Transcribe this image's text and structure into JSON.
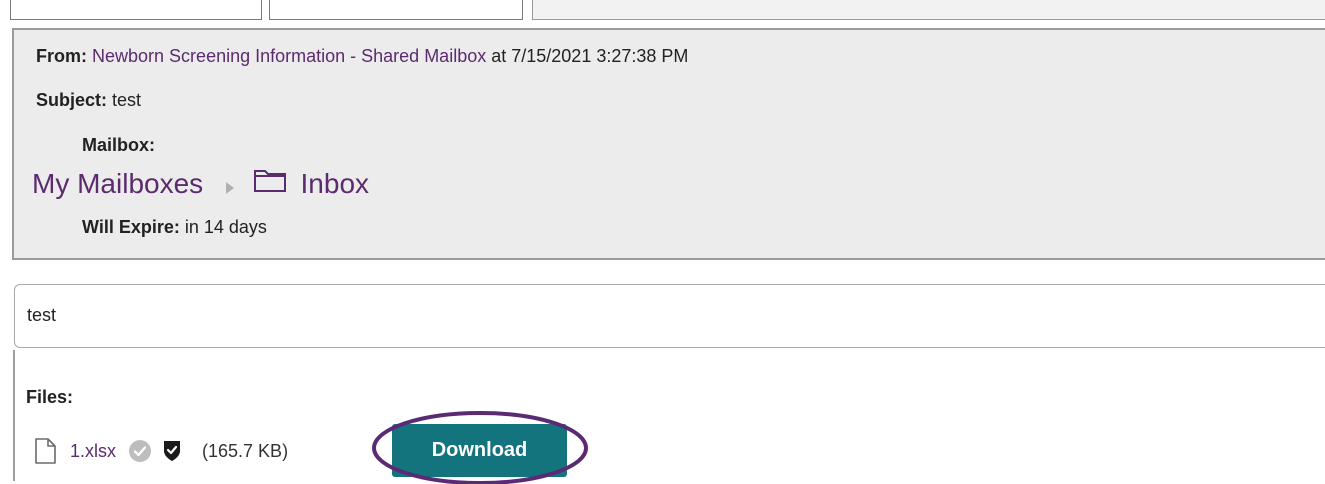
{
  "message": {
    "from_label": "From:",
    "from_name": "Newborn Screening Information - Shared Mailbox",
    "from_at": "at 7/15/2021 3:27:38 PM",
    "subject_label": "Subject:",
    "subject_value": "test",
    "mailbox_label": "Mailbox:",
    "breadcrumb": {
      "root": "My Mailboxes",
      "folder": "Inbox"
    },
    "expire_label": "Will Expire:",
    "expire_value": "in 14 days",
    "body_text": "test"
  },
  "files": {
    "label": "Files:",
    "items": [
      {
        "name": "1.xlsx",
        "size": "(165.7 KB)",
        "icons": [
          "file-icon",
          "verified-check-icon",
          "shield-icon"
        ]
      }
    ],
    "download_label": "Download"
  },
  "colors": {
    "link_purple": "#5b2b6e",
    "header_bg": "#ececec",
    "download_teal": "#13747e",
    "highlight_purple": "#5a2a75"
  }
}
